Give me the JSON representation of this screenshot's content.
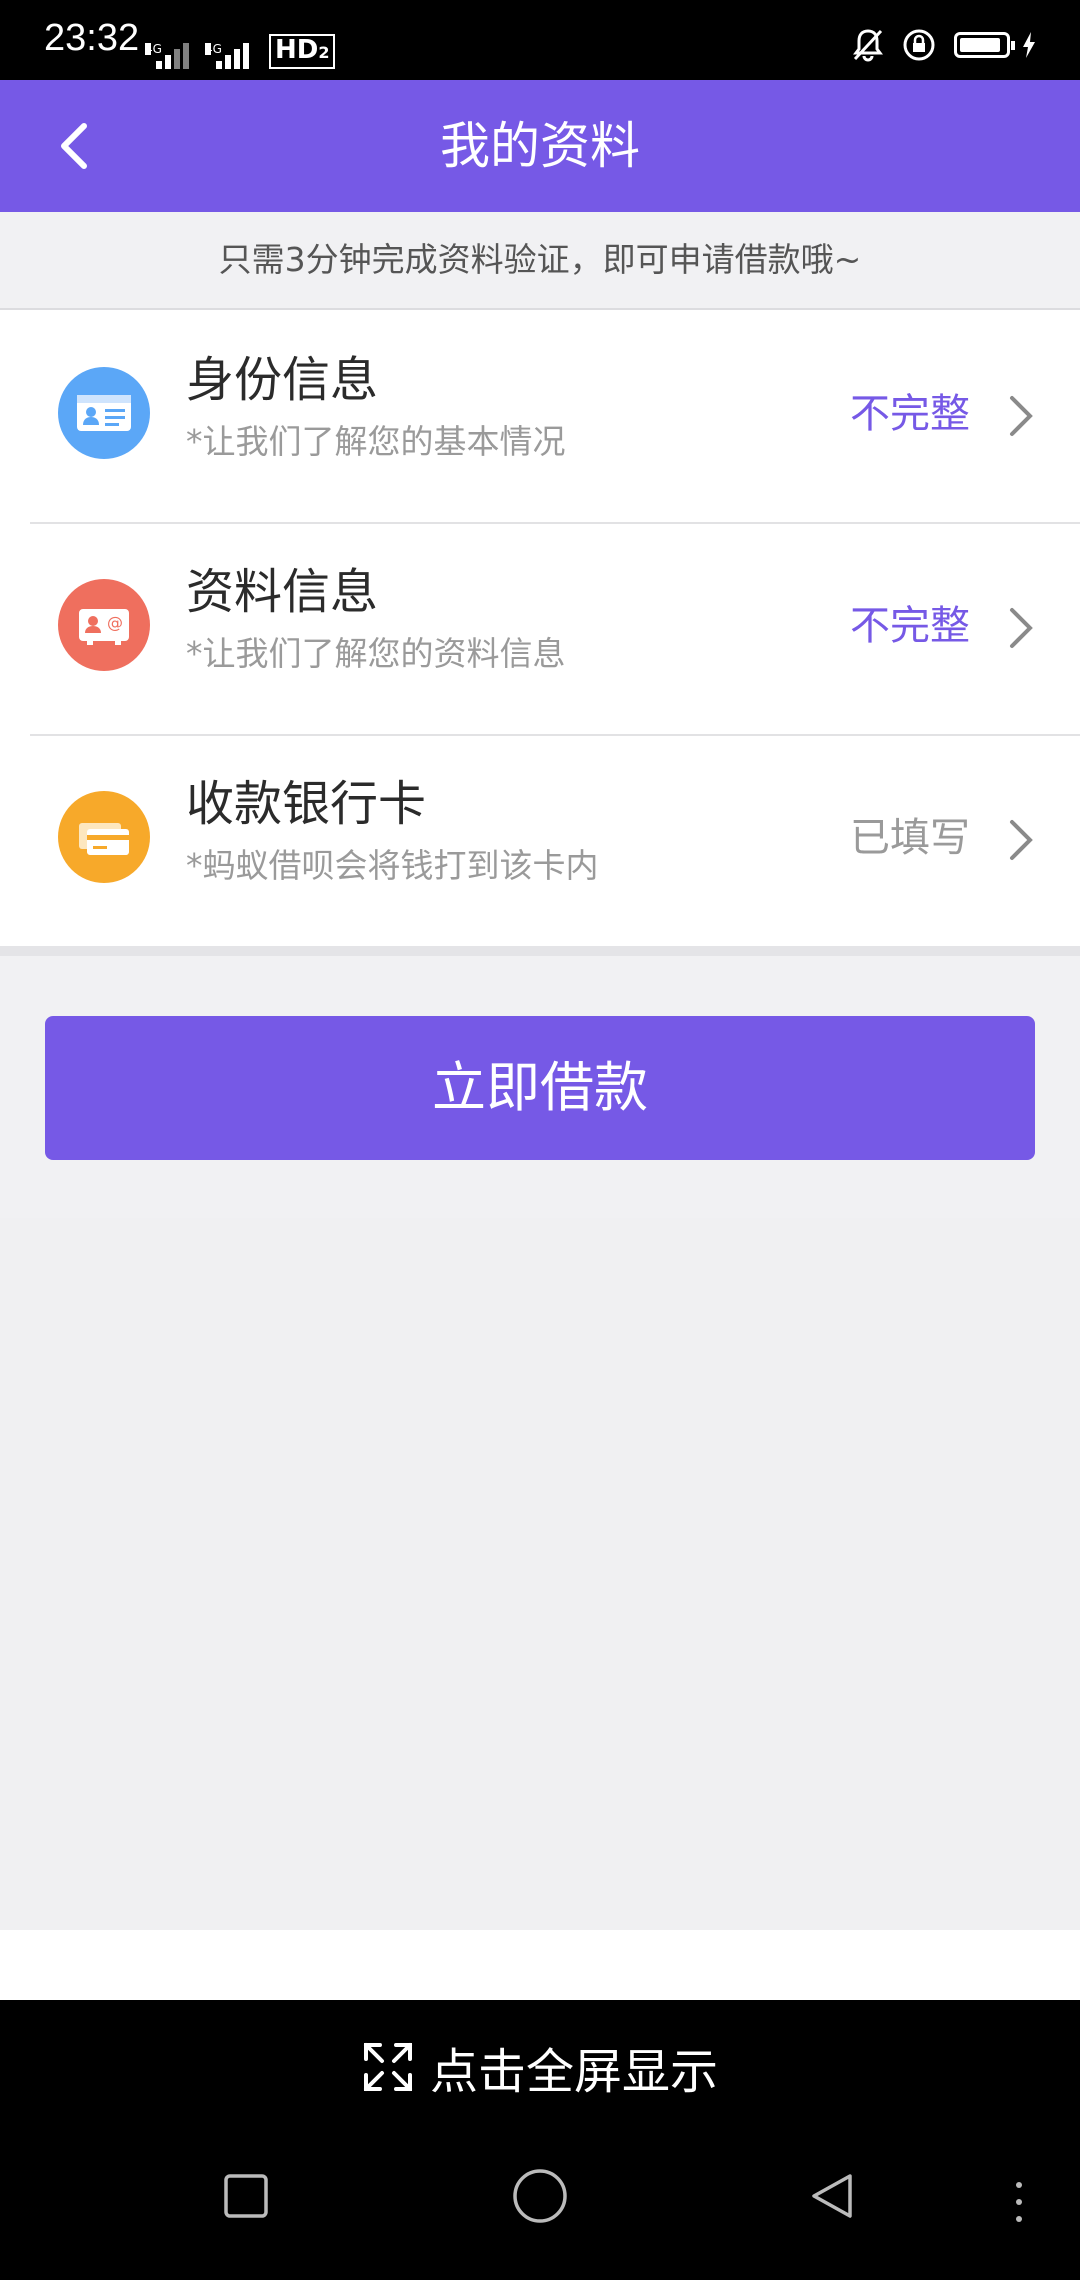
{
  "status_bar": {
    "time": "23:32",
    "network_1": "4G",
    "network_2": "4G",
    "hd_label": "HD",
    "hd_sub": "2",
    "battery_level_percent": 90
  },
  "header": {
    "title": "我的资料",
    "back_icon": "chevron-left-icon"
  },
  "notice": "只需3分钟完成资料验证，即可申请借款哦~",
  "rows": [
    {
      "title": "身份信息",
      "subtitle": "*让我们了解您的基本情况",
      "status": "不完整",
      "icon": "id-card-icon",
      "icon_color": "#5ba7f7",
      "status_color": "#7659e6"
    },
    {
      "title": "资料信息",
      "subtitle": "*让我们了解您的资料信息",
      "status": "不完整",
      "icon": "contact-card-icon",
      "icon_color": "#ef6f5e",
      "status_color": "#7659e6"
    },
    {
      "title": "收款银行卡",
      "subtitle": "*蚂蚁借呗会将钱打到该卡内",
      "status": "已填写",
      "icon": "bank-card-icon",
      "icon_color": "#f7a92a",
      "status_color": "#9a9a9a"
    }
  ],
  "cta": {
    "label": "立即借款"
  },
  "fullscreen": {
    "label": "点击全屏显示",
    "icon": "expand-icon"
  },
  "colors": {
    "accent": "#7659e6",
    "background": "#f1f1f3"
  }
}
